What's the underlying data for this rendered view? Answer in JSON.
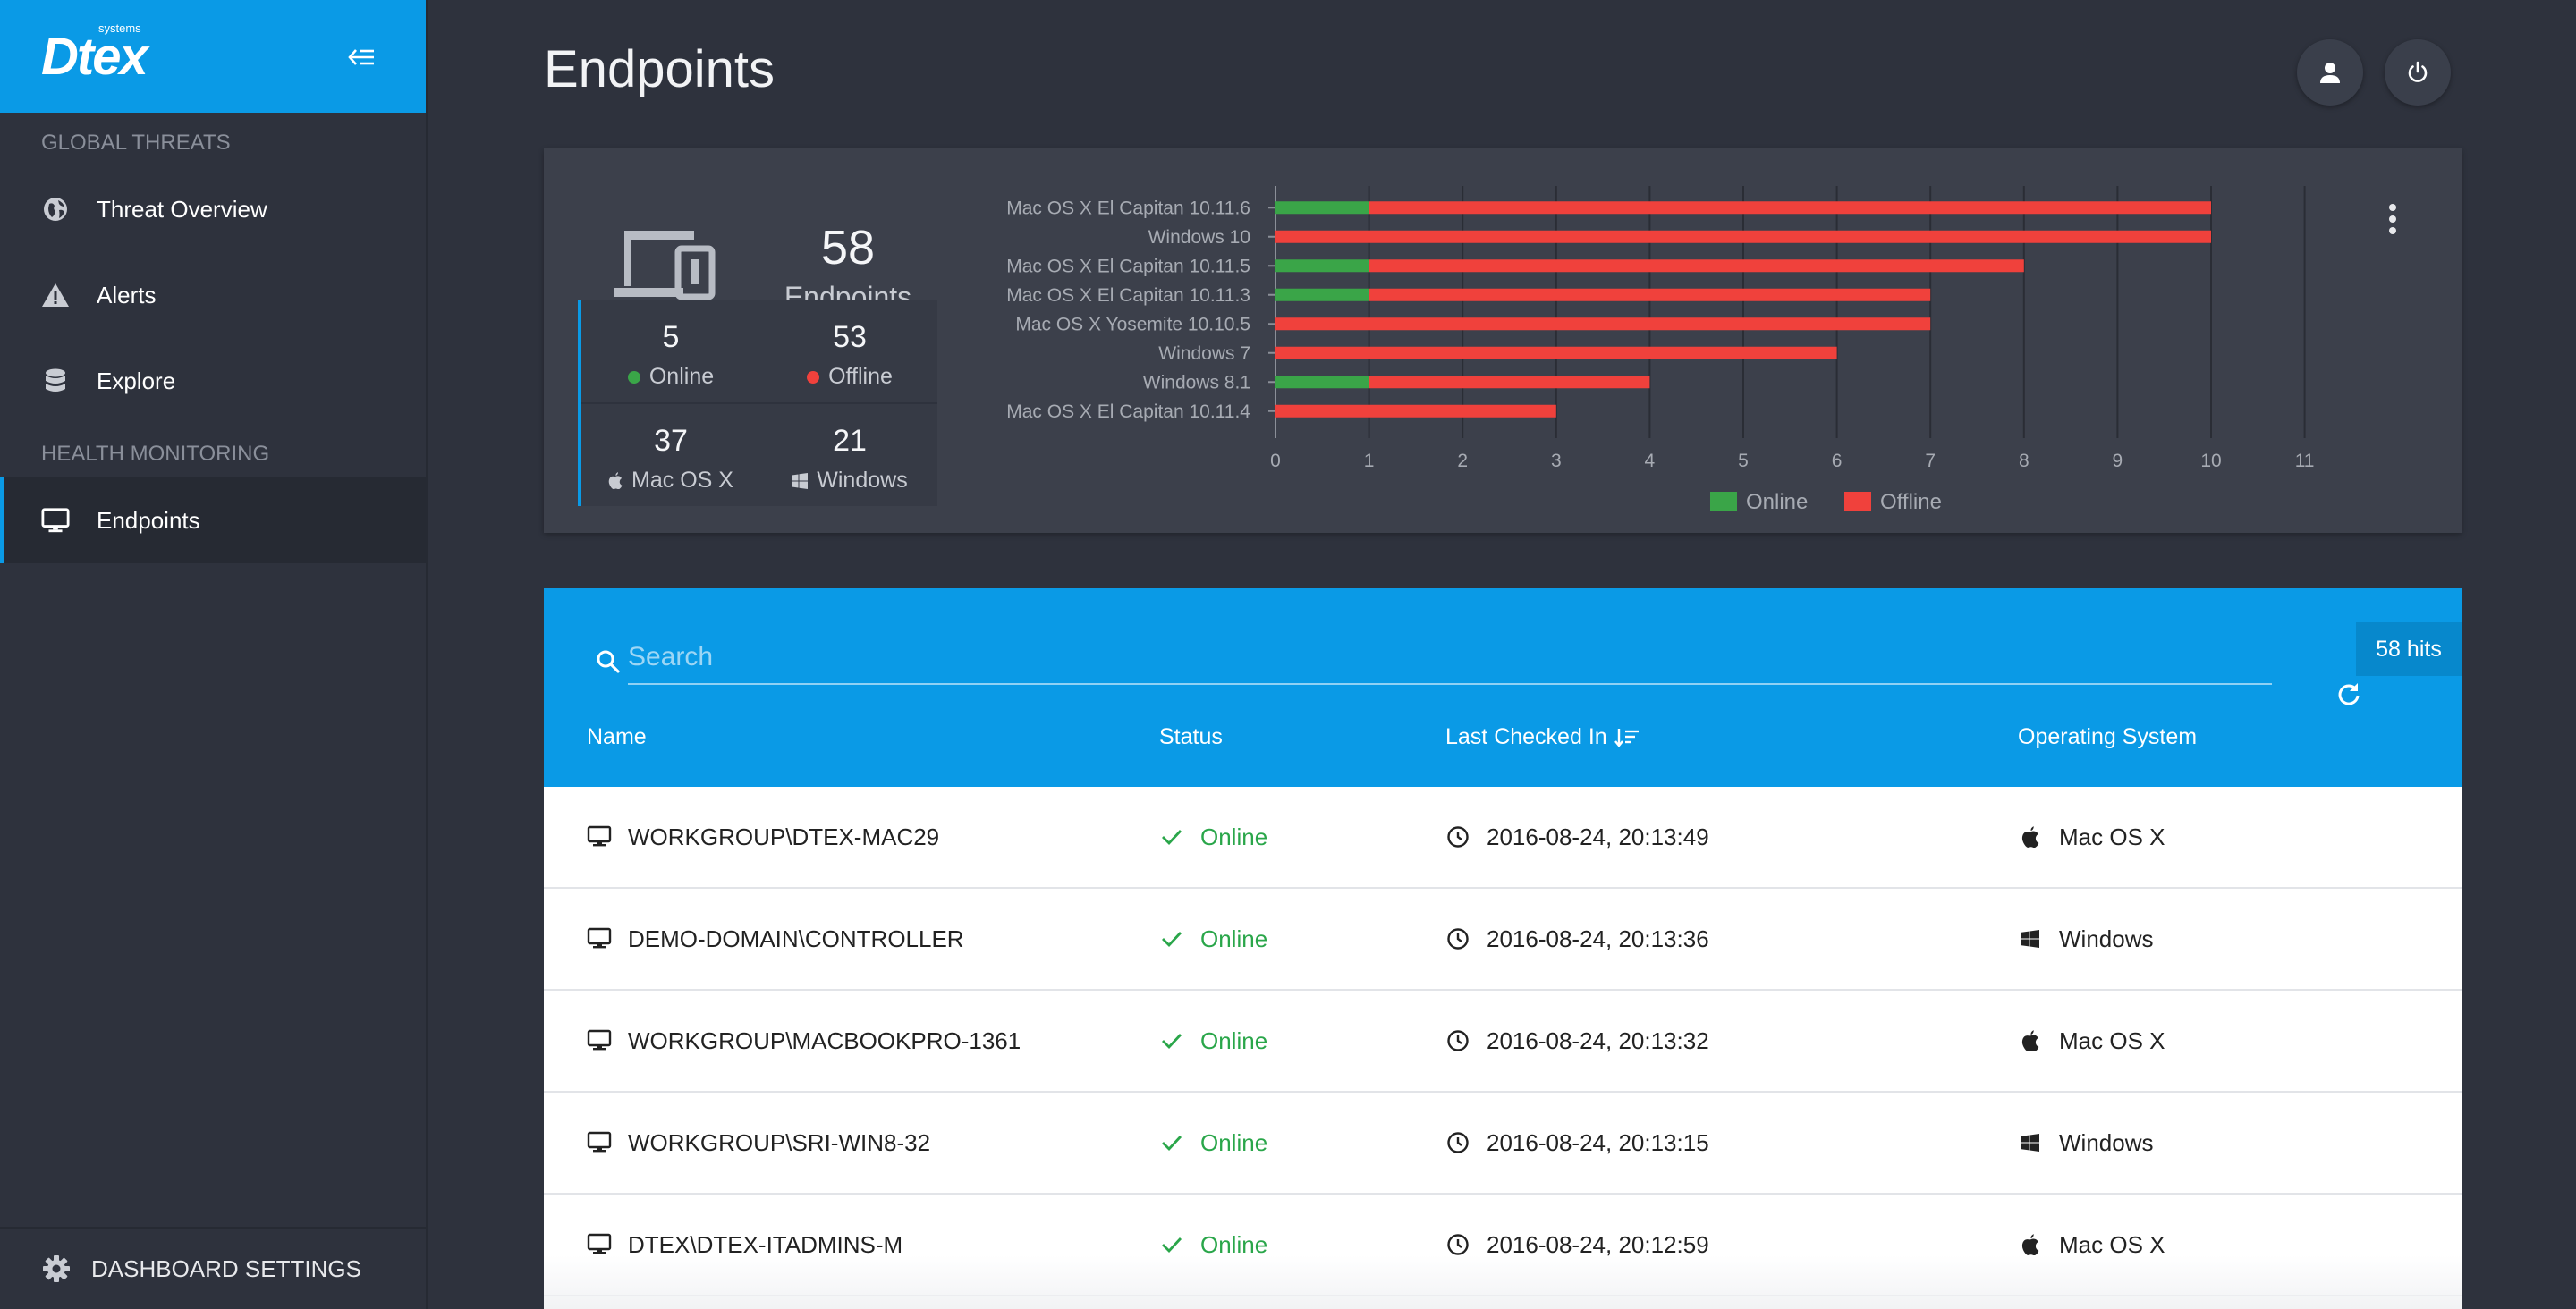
{
  "brand": {
    "logo_text": "Dtex",
    "logo_sub": "systems"
  },
  "sidebar": {
    "sections": [
      {
        "title": "GLOBAL THREATS",
        "items": [
          {
            "label": "Threat Overview",
            "icon": "globe-icon"
          },
          {
            "label": "Alerts",
            "icon": "warning-icon"
          },
          {
            "label": "Explore",
            "icon": "database-icon"
          }
        ]
      },
      {
        "title": "HEALTH MONITORING",
        "items": [
          {
            "label": "Endpoints",
            "icon": "monitor-icon",
            "active": true
          }
        ]
      }
    ],
    "settings_label": "DASHBOARD SETTINGS"
  },
  "header": {
    "title": "Endpoints",
    "user_icon": "user-icon",
    "power_icon": "power-icon"
  },
  "summary": {
    "total": "58",
    "total_label": "Endpoints",
    "online": "5",
    "online_label": "Online",
    "offline": "53",
    "offline_label": "Offline",
    "mac": "37",
    "mac_label": "Mac OS X",
    "windows": "21",
    "windows_label": "Windows"
  },
  "colors": {
    "accent": "#0a9ae6",
    "online": "#3aa548",
    "offline": "#f0413c",
    "online_text": "#2aa64a"
  },
  "chart_data": {
    "type": "bar",
    "orientation": "horizontal",
    "stacked": true,
    "categories": [
      "Mac OS X El Capitan 10.11.6",
      "Windows 10",
      "Mac OS X El Capitan 10.11.5",
      "Mac OS X El Capitan 10.11.3",
      "Mac OS X Yosemite 10.10.5",
      "Windows 7",
      "Windows 8.1",
      "Mac OS X El Capitan 10.11.4"
    ],
    "series": [
      {
        "name": "Online",
        "values": [
          1,
          0,
          1,
          1,
          0,
          0,
          1,
          0
        ]
      },
      {
        "name": "Offline",
        "values": [
          9,
          10,
          7,
          6,
          7,
          6,
          3,
          3
        ]
      }
    ],
    "xlim": [
      0,
      11
    ],
    "xticks": [
      "0",
      "1",
      "2",
      "3",
      "4",
      "5",
      "6",
      "7",
      "8",
      "9",
      "10",
      "11"
    ],
    "grid": true,
    "legend": "bottom"
  },
  "table": {
    "search_placeholder": "Search",
    "hits": "58 hits",
    "columns": [
      "Name",
      "Status",
      "Last Checked In",
      "Operating System"
    ],
    "rows": [
      {
        "name": "WORKGROUP\\DTEX-MAC29",
        "status": "Online",
        "checked": "2016-08-24, 20:13:49",
        "os": "Mac OS X",
        "os_icon": "apple-icon"
      },
      {
        "name": "DEMO-DOMAIN\\CONTROLLER",
        "status": "Online",
        "checked": "2016-08-24, 20:13:36",
        "os": "Windows",
        "os_icon": "windows-icon"
      },
      {
        "name": "WORKGROUP\\MACBOOKPRO-1361",
        "status": "Online",
        "checked": "2016-08-24, 20:13:32",
        "os": "Mac OS X",
        "os_icon": "apple-icon"
      },
      {
        "name": "WORKGROUP\\SRI-WIN8-32",
        "status": "Online",
        "checked": "2016-08-24, 20:13:15",
        "os": "Windows",
        "os_icon": "windows-icon"
      },
      {
        "name": "DTEX\\DTEX-ITADMINS-M",
        "status": "Online",
        "checked": "2016-08-24, 20:12:59",
        "os": "Mac OS X",
        "os_icon": "apple-icon"
      }
    ]
  }
}
